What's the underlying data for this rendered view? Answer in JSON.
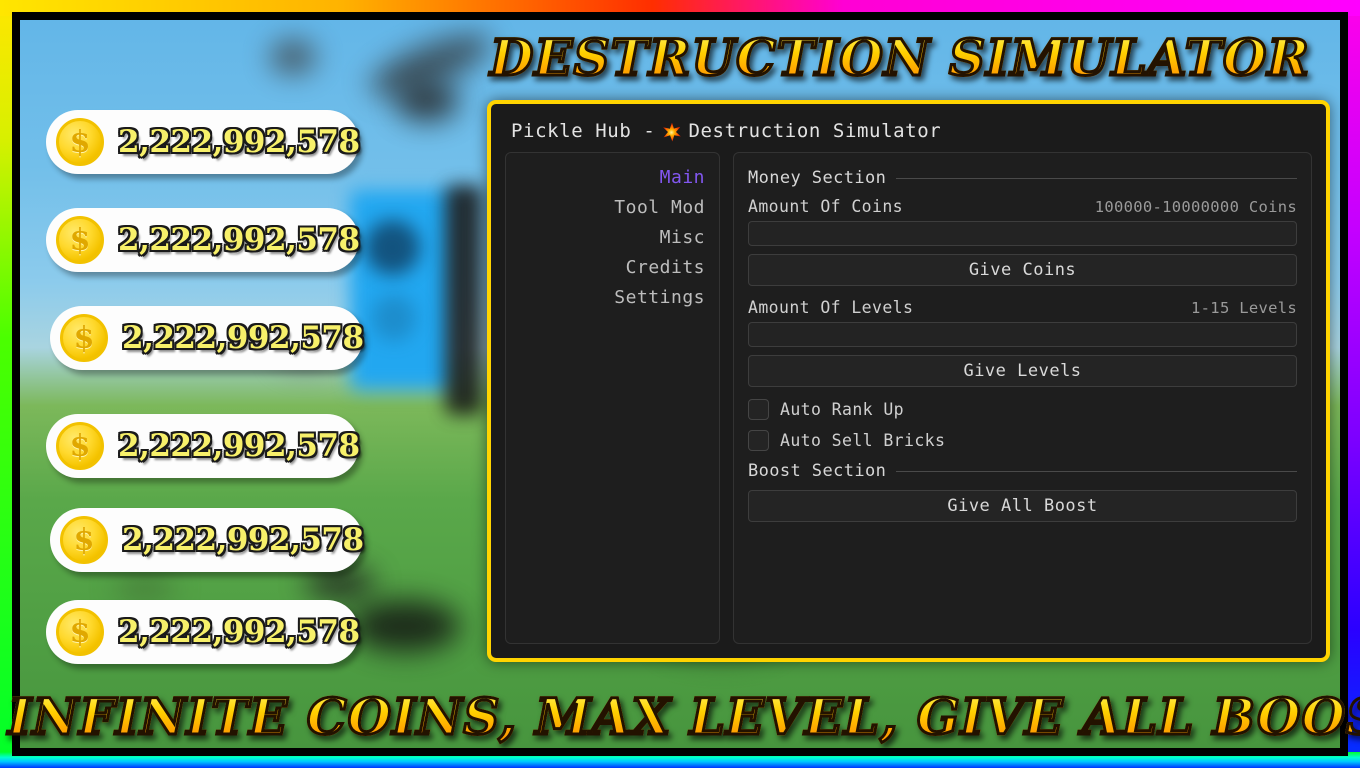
{
  "banner": {
    "top_title": "DESTRUCTION SIMULATOR",
    "bottom_title": "INFINITE COINS, MAX LEVEL, GIVE ALL BOOSTS",
    "accent_color": "#ffd000",
    "outline_color": "#231200"
  },
  "game_overlay": {
    "coin_pills": [
      {
        "icon": "coin-icon",
        "symbol": "$",
        "value": "2,222,992,578"
      },
      {
        "icon": "coin-icon",
        "symbol": "$",
        "value": "2,222,992,578"
      },
      {
        "icon": "coin-icon",
        "symbol": "$",
        "value": "2,222,992,578"
      },
      {
        "icon": "coin-icon",
        "symbol": "$",
        "value": "2,222,992,578"
      },
      {
        "icon": "coin-icon",
        "symbol": "$",
        "value": "2,222,992,578"
      },
      {
        "icon": "coin-icon",
        "symbol": "$",
        "value": "2,222,992,578"
      }
    ]
  },
  "hub": {
    "title_prefix": "Pickle Hub -",
    "title_icon": "starburst-icon",
    "title_suffix": "Destruction Simulator",
    "border_color": "#ffd400",
    "sidebar": {
      "items": [
        {
          "label": "Main",
          "active": true
        },
        {
          "label": "Tool Mod",
          "active": false
        },
        {
          "label": "Misc",
          "active": false
        },
        {
          "label": "Credits",
          "active": false
        },
        {
          "label": "Settings",
          "active": false
        }
      ],
      "active_color": "#8257f0"
    },
    "content": {
      "money_section": {
        "heading": "Money Section",
        "coins_label": "Amount Of Coins",
        "coins_hint": "100000-10000000 Coins",
        "coins_value": "",
        "coins_placeholder": "",
        "give_coins_label": "Give Coins",
        "levels_label": "Amount Of Levels",
        "levels_hint": "1-15 Levels",
        "levels_value": "",
        "levels_placeholder": "",
        "give_levels_label": "Give Levels",
        "auto_rank_up_label": "Auto Rank Up",
        "auto_rank_up_checked": false,
        "auto_sell_bricks_label": "Auto Sell Bricks",
        "auto_sell_bricks_checked": false
      },
      "boost_section": {
        "heading": "Boost Section",
        "give_all_boost_label": "Give All Boost"
      }
    }
  }
}
